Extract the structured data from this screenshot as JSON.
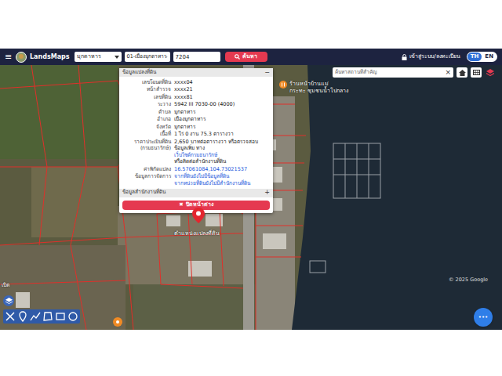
{
  "header": {
    "menu_icon": "≡",
    "logo": "LandsMaps",
    "province": "มุกดาหาร",
    "district": "01-เมืองมุกดาหาร",
    "parcel_no": "7204",
    "search_button": "ค้นหา",
    "login": "เข้าสู่ระบบ/ลงทะเบียน",
    "languages": [
      {
        "label": "TH",
        "selected": true
      },
      {
        "label": "EN",
        "selected": false
      }
    ]
  },
  "place_search": {
    "placeholder": "ค้นหาสถานที่สำคัญ",
    "clear": "×"
  },
  "popup": {
    "title": "ข้อมูลแปลงที่ดิน",
    "collapse": "−",
    "rows": [
      {
        "label": "เลขโฉนดที่ดิน",
        "segments": [
          {
            "text": "xxxx04",
            "link": false
          }
        ]
      },
      {
        "label": "หน้าสำรวจ",
        "segments": [
          {
            "text": "xxxx21",
            "link": false
          }
        ]
      },
      {
        "label": "เลขที่ดิน",
        "segments": [
          {
            "text": "xxxx81",
            "link": false
          }
        ]
      },
      {
        "label": "ระวาง",
        "segments": [
          {
            "text": "5942 III 7030-00 (4000)",
            "link": false
          }
        ]
      },
      {
        "label": "ตำบล",
        "segments": [
          {
            "text": "มุกดาหาร",
            "link": false
          }
        ]
      },
      {
        "label": "อำเภอ",
        "segments": [
          {
            "text": "เมืองมุกดาหาร",
            "link": false
          }
        ]
      },
      {
        "label": "จังหวัด",
        "segments": [
          {
            "text": "มุกดาหาร",
            "link": false
          }
        ]
      },
      {
        "label": "เนื้อที่",
        "segments": [
          {
            "text": "1 ไร่ 0 งาน 75.3 ตารางวา",
            "link": false
          }
        ]
      },
      {
        "label": "ราคาประเมินที่ดิน (กรมธนารักษ์)",
        "segments": [
          {
            "text": "2,650 บาทต่อตารางวา หรือตรวจสอบข้อมูลเพิ่ม ทาง",
            "link": false
          },
          {
            "text": "เว็บไซต์กรมธนารักษ์",
            "link": true
          },
          {
            "text": "หรือติดต่อสำนักงานที่ดิน",
            "link": false
          }
        ]
      },
      {
        "label": "ค่าพิกัดแปลง",
        "segments": [
          {
            "text": "16.57061084,104.73021537",
            "link": true
          }
        ]
      },
      {
        "label": "ข้อมูลการจัดการ",
        "segments": [
          {
            "text": "จากที่ดินยังไม่มีข้อมูลที่ดิน",
            "link": true
          },
          {
            "text": "จากหน่วยที่ดินยังไม่มีสำนักงานที่ดิน",
            "link": true
          }
        ]
      }
    ],
    "office_section": {
      "title": "ข้อมูลสำนักงานที่ดิน",
      "toggle": "+",
      "expanded": false
    },
    "close_icon": "✖",
    "close_label": "ปิดหน้าต่าง"
  },
  "map": {
    "place_label_lines": [
      "ร้านหน้าบ้านแม่",
      "กระทะ ชุมชนน้ำโปกลาง"
    ],
    "pin_label": "ตำแหน่งแปลงที่ดิน",
    "edge_label": "เบิต",
    "watermark": "© 2025 Google",
    "fab": "•••"
  }
}
